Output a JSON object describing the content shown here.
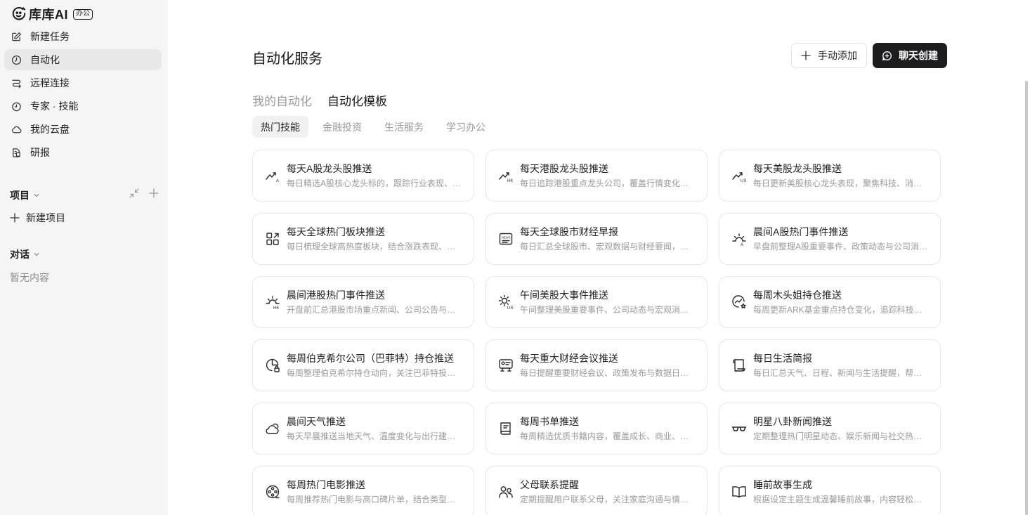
{
  "brand": {
    "name": "库库AI",
    "badge": "办公"
  },
  "nav": [
    {
      "label": "新建任务",
      "icon": "edit-icon",
      "active": false
    },
    {
      "label": "自动化",
      "icon": "clock-icon",
      "active": true
    },
    {
      "label": "远程连接",
      "icon": "route-icon",
      "active": false
    },
    {
      "label": "专家 · 技能",
      "icon": "timer-icon",
      "active": false
    },
    {
      "label": "我的云盘",
      "icon": "cloud-icon",
      "active": false
    },
    {
      "label": "研报",
      "icon": "report-icon",
      "active": false
    }
  ],
  "projects": {
    "title": "项目",
    "new_label": "新建项目"
  },
  "chats": {
    "title": "对话",
    "empty": "暂无内容"
  },
  "main": {
    "title": "自动化服务",
    "manual_add": "手动添加",
    "chat_create": "聊天创建",
    "tabs": [
      {
        "label": "我的自动化",
        "active": false
      },
      {
        "label": "自动化模板",
        "active": true
      }
    ],
    "chips": [
      {
        "label": "热门技能",
        "active": true
      },
      {
        "label": "金融投资",
        "active": false
      },
      {
        "label": "生活服务",
        "active": false
      },
      {
        "label": "学习办公",
        "active": false
      }
    ],
    "cards": [
      {
        "title": "每天A股龙头股推送",
        "desc": "每日精选A股核心龙头标的，跟踪行业表现、资金动向与技术走势",
        "icon": "trend-a-icon"
      },
      {
        "title": "每天港股龙头股推送",
        "desc": "每日追踪港股重点龙头公司，覆盖行情变化、资金流向与市场热度",
        "icon": "trend-hk-icon"
      },
      {
        "title": "每天美股龙头股推送",
        "desc": "每日更新美股核心龙头表现，聚焦科技、消费与金融板块动态",
        "icon": "trend-us-icon"
      },
      {
        "title": "每天全球热门板块推送",
        "desc": "每日梳理全球高热度板块，结合涨跌表现、资金热度与新闻催化",
        "icon": "grid-icon"
      },
      {
        "title": "每天全球股市财经早报",
        "desc": "每日汇总全球股市、宏观数据与财经要闻，快速掌握市场脉络",
        "icon": "news-icon"
      },
      {
        "title": "晨间A股热门事件推送",
        "desc": "早盘前整理A股重要事件、政策动态与公司消息，助力开盘决策",
        "icon": "sunrise-a-icon"
      },
      {
        "title": "晨间港股热门事件推送",
        "desc": "开盘前汇总港股市场重点新闻、公司公告与行业动态",
        "icon": "sunrise-hk-icon"
      },
      {
        "title": "午间美股大事件推送",
        "desc": "午间整理美股重要事件、公司动态与宏观消息，及时跟进市场",
        "icon": "sun-us-icon"
      },
      {
        "title": "每周木头姐持仓推送",
        "desc": "每周更新ARK基金重点持仓变化，追踪科技成长投资方向",
        "icon": "chart-star-icon"
      },
      {
        "title": "每周伯克希尔公司（巴菲特）持仓推送",
        "desc": "每周整理伯克希尔持仓动向，关注巴菲特投资组合调整",
        "icon": "pie-lock-icon"
      },
      {
        "title": "每天重大财经会议推送",
        "desc": "每日提醒重要财经会议、政策发布与数据日程，把握关键节点",
        "icon": "meeting-icon"
      },
      {
        "title": "每日生活简报",
        "desc": "每日汇总天气、日程、新闻与生活提醒，帮助规划美好一天",
        "icon": "scroll-icon"
      },
      {
        "title": "晨间天气推送",
        "desc": "每天早晨推送当地天气、温度变化与出行建议，轻松安排行程",
        "icon": "cloud-sun-icon"
      },
      {
        "title": "每周书单推送",
        "desc": "每周精选优质书籍内容，覆盖成长、商业、文学等多个领域",
        "icon": "book-icon"
      },
      {
        "title": "明星八卦新闻推送",
        "desc": "定期整理热门明星动态、娱乐新闻与社交热点话题",
        "icon": "glasses-icon"
      },
      {
        "title": "每周热门电影推送",
        "desc": "每周推荐热门电影与高口碑片单，结合类型、评分与观影建议",
        "icon": "film-reel-icon"
      },
      {
        "title": "父母联系提醒",
        "desc": "定期提醒用户联系父母，关注家庭沟通与情感陪伴",
        "icon": "users-icon"
      },
      {
        "title": "睡前故事生成",
        "desc": "根据设定主题生成温馨睡前故事，内容轻松自然适合亲子阅读",
        "icon": "open-book-icon"
      }
    ]
  }
}
